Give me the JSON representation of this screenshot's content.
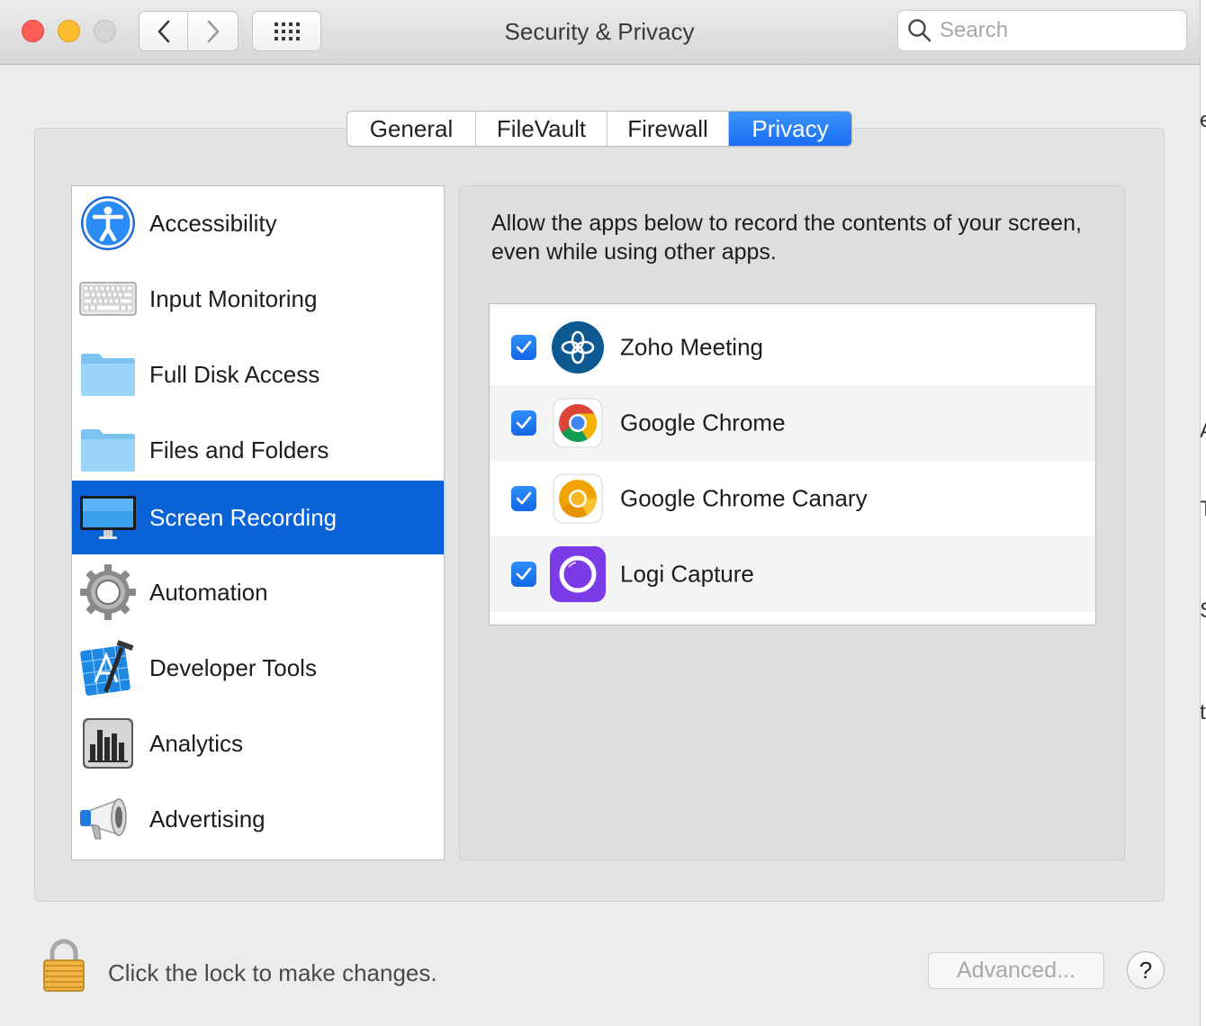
{
  "window": {
    "title": "Security & Privacy",
    "search_placeholder": "Search",
    "traffic_lights": [
      "close",
      "minimize",
      "zoom-disabled"
    ]
  },
  "tabs": [
    {
      "label": "General",
      "active": false
    },
    {
      "label": "FileVault",
      "active": false
    },
    {
      "label": "Firewall",
      "active": false
    },
    {
      "label": "Privacy",
      "active": true
    }
  ],
  "categories": [
    {
      "label": "Accessibility",
      "icon": "accessibility-icon"
    },
    {
      "label": "Input Monitoring",
      "icon": "keyboard-icon"
    },
    {
      "label": "Full Disk Access",
      "icon": "folder-icon"
    },
    {
      "label": "Files and Folders",
      "icon": "folder-icon"
    },
    {
      "label": "Screen Recording",
      "icon": "display-icon",
      "selected": true
    },
    {
      "label": "Automation",
      "icon": "gear-icon"
    },
    {
      "label": "Developer Tools",
      "icon": "xcode-icon"
    },
    {
      "label": "Analytics",
      "icon": "analytics-icon"
    },
    {
      "label": "Advertising",
      "icon": "megaphone-icon"
    }
  ],
  "content": {
    "description": "Allow the apps below to record the contents of your screen, even while using other apps.",
    "apps": [
      {
        "name": "Zoho Meeting",
        "checked": true,
        "icon": "zoho-meeting-icon"
      },
      {
        "name": "Google Chrome",
        "checked": true,
        "icon": "chrome-icon"
      },
      {
        "name": "Google Chrome Canary",
        "checked": true,
        "icon": "chrome-canary-icon"
      },
      {
        "name": "Logi Capture",
        "checked": true,
        "icon": "logi-capture-icon"
      }
    ]
  },
  "footer": {
    "lock_message": "Click the lock to make changes.",
    "advanced_label": "Advanced...",
    "help_label": "?"
  },
  "colors": {
    "accent": "#1a6ff2",
    "selection": "#0a62d7",
    "window_bg": "#ececec"
  }
}
